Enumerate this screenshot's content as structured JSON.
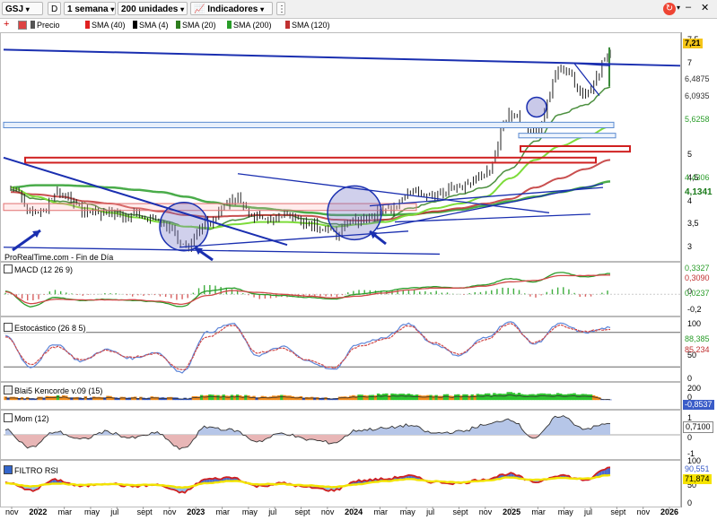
{
  "toolbar": {
    "symbol": "GSJ",
    "d_label": "D",
    "period": "1 semana",
    "units": "200 unidades",
    "indicators": "Indicadores"
  },
  "legend": {
    "price": "Precio",
    "sma40": "SMA (40)",
    "sma4": "SMA (4)",
    "sma20": "SMA (20)",
    "sma200": "SMA (200)",
    "sma120": "SMA (120)"
  },
  "colors": {
    "sma40": "#e02020",
    "sma4": "#000000",
    "sma20": "#2e7d1e",
    "sma200": "#2a9d2a",
    "sma120": "#c03030",
    "trendline": "#1a2fb0",
    "zone_red": "#d02020",
    "zone_blue": "#5a8ad0"
  },
  "watermark": "ProRealTime.com - Fin de Día",
  "panels": {
    "price": {
      "yticks": [
        "7,5",
        "7",
        "5",
        "4,5",
        "4",
        "3,5",
        "3"
      ],
      "boxes": {
        "last": "7,21",
        "v1": "6,4875",
        "v2": "6,0935",
        "v3": "5,6258",
        "v4": "4,4306",
        "v5": "4,1341"
      }
    },
    "macd": {
      "title": "MACD (12 26 9)",
      "yticks": [
        "0",
        "-0,2"
      ],
      "values": [
        "0,3327",
        "0,3090",
        "0,0237"
      ]
    },
    "stoch": {
      "title": "Estocástico (26 8 5)",
      "yticks": [
        "100",
        "50",
        "0"
      ],
      "values": [
        "88,385",
        "85,234"
      ]
    },
    "blai5": {
      "title": "Blai5 Kencorde v.09 (15)",
      "yticks": [
        "200",
        "0"
      ],
      "values": [
        "-0,8537"
      ]
    },
    "mom": {
      "title": "Mom (12)",
      "yticks": [
        "1",
        "0",
        "-1"
      ],
      "values": [
        "0,7100"
      ]
    },
    "rsi": {
      "title": "FILTRO RSI",
      "yticks": [
        "100",
        "50",
        "0"
      ],
      "values": [
        "90,551",
        "71,874"
      ]
    }
  },
  "xaxis": [
    "nov",
    "2022",
    "mar",
    "may",
    "jul",
    "sept",
    "nov",
    "2023",
    "mar",
    "may",
    "jul",
    "sept",
    "nov",
    "2024",
    "mar",
    "may",
    "jul",
    "sept",
    "nov",
    "2025",
    "mar",
    "may",
    "jul",
    "sept",
    "nov",
    "2026"
  ],
  "chart_data": [
    {
      "type": "line",
      "panel": "price",
      "x": [
        "2021-09",
        "2021-11",
        "2022-01",
        "2022-03",
        "2022-05",
        "2022-07",
        "2022-09",
        "2022-11",
        "2023-01",
        "2023-03",
        "2023-05",
        "2023-07",
        "2023-09",
        "2023-11",
        "2024-01",
        "2024-03",
        "2024-05",
        "2024-07",
        "2024-09",
        "2024-11",
        "2025-01",
        "2025-03",
        "2025-05",
        "2025-07",
        "2025-08"
      ],
      "series": [
        {
          "name": "Precio",
          "values": [
            4.3,
            3.75,
            4.2,
            3.8,
            3.7,
            3.7,
            3.55,
            3.05,
            3.6,
            4.05,
            3.6,
            3.7,
            3.55,
            3.3,
            3.6,
            3.8,
            4.2,
            4.2,
            4.3,
            4.6,
            5.9,
            5.5,
            6.9,
            6.3,
            7.21
          ]
        },
        {
          "name": "SMA (20)",
          "values": [
            4.25,
            4.05,
            4.0,
            3.95,
            3.8,
            3.7,
            3.6,
            3.45,
            3.4,
            3.6,
            3.7,
            3.7,
            3.6,
            3.5,
            3.5,
            3.6,
            3.85,
            4.0,
            4.15,
            4.3,
            4.7,
            5.3,
            5.9,
            6.1,
            6.4875
          ]
        },
        {
          "name": "SMA (200)",
          "values": [
            4.3,
            4.35,
            4.35,
            4.33,
            4.3,
            4.25,
            4.2,
            4.1,
            3.98,
            3.9,
            3.85,
            3.8,
            3.75,
            3.7,
            3.7,
            3.7,
            3.72,
            3.76,
            3.82,
            3.9,
            4.0,
            4.1,
            4.2,
            4.3,
            4.4306
          ]
        },
        {
          "name": "SMA (120)",
          "values": [
            4.2,
            4.15,
            4.1,
            4.0,
            3.95,
            3.85,
            3.78,
            3.7,
            3.66,
            3.68,
            3.7,
            3.7,
            3.68,
            3.6,
            3.58,
            3.6,
            3.7,
            3.78,
            3.85,
            3.95,
            4.05,
            4.3,
            4.5,
            4.7,
            4.9
          ]
        }
      ],
      "ylim": [
        2.8,
        7.6
      ]
    },
    {
      "type": "line",
      "panel": "macd",
      "series": [
        {
          "name": "MACD",
          "values": [
            0.05,
            -0.2,
            -0.05,
            -0.1,
            -0.08,
            -0.1,
            -0.12,
            -0.2,
            0.05,
            0.1,
            0.0,
            -0.02,
            -0.05,
            -0.08,
            0.0,
            0.05,
            0.1,
            0.12,
            0.1,
            0.15,
            0.25,
            0.2,
            0.35,
            0.28,
            0.3327
          ]
        },
        {
          "name": "Signal",
          "values": [
            0.04,
            -0.15,
            -0.08,
            -0.09,
            -0.09,
            -0.09,
            -0.11,
            -0.16,
            -0.02,
            0.06,
            0.03,
            0.0,
            -0.03,
            -0.06,
            -0.03,
            0.02,
            0.07,
            0.1,
            0.1,
            0.13,
            0.2,
            0.22,
            0.3,
            0.3,
            0.309
          ]
        }
      ],
      "ylim": [
        -0.3,
        0.45
      ]
    },
    {
      "type": "line",
      "panel": "stoch",
      "series": [
        {
          "name": "%K",
          "values": [
            75,
            20,
            60,
            30,
            50,
            35,
            45,
            10,
            80,
            95,
            40,
            55,
            30,
            15,
            60,
            70,
            95,
            60,
            40,
            70,
            98,
            60,
            95,
            80,
            88.385
          ]
        },
        {
          "name": "%D",
          "values": [
            72,
            25,
            55,
            32,
            48,
            37,
            43,
            14,
            72,
            92,
            45,
            52,
            32,
            18,
            55,
            68,
            92,
            62,
            42,
            66,
            95,
            62,
            92,
            82,
            85.234
          ]
        }
      ],
      "ylim": [
        0,
        100
      ]
    },
    {
      "type": "area",
      "panel": "blai5",
      "series": [
        {
          "name": "Blai5",
          "values": [
            40,
            20,
            50,
            30,
            40,
            30,
            30,
            20,
            60,
            60,
            40,
            50,
            30,
            20,
            60,
            70,
            70,
            60,
            60,
            70,
            90,
            70,
            80,
            70,
            -0.8537
          ]
        }
      ],
      "ylim": [
        -100,
        200
      ]
    },
    {
      "type": "area",
      "panel": "mom",
      "series": [
        {
          "name": "Mom (12)",
          "values": [
            0.3,
            -0.8,
            0.2,
            -0.3,
            0.2,
            -0.2,
            0.1,
            -0.9,
            0.5,
            0.3,
            -0.4,
            0.1,
            -0.3,
            -0.5,
            0.3,
            0.4,
            0.6,
            0.1,
            0.2,
            0.6,
            1.0,
            -0.2,
            1.2,
            0.4,
            0.71
          ]
        }
      ],
      "ylim": [
        -1.3,
        1.3
      ]
    },
    {
      "type": "area",
      "panel": "rsi",
      "series": [
        {
          "name": "RSI",
          "values": [
            55,
            35,
            60,
            45,
            52,
            45,
            48,
            30,
            62,
            66,
            45,
            52,
            42,
            35,
            58,
            62,
            70,
            55,
            52,
            62,
            75,
            55,
            72,
            60,
            90.551
          ]
        },
        {
          "name": "Filtro",
          "values": [
            52,
            45,
            52,
            48,
            50,
            48,
            48,
            42,
            52,
            58,
            50,
            50,
            47,
            43,
            50,
            57,
            62,
            57,
            54,
            58,
            66,
            60,
            65,
            63,
            71.874
          ]
        }
      ],
      "ylim": [
        0,
        100
      ]
    }
  ]
}
